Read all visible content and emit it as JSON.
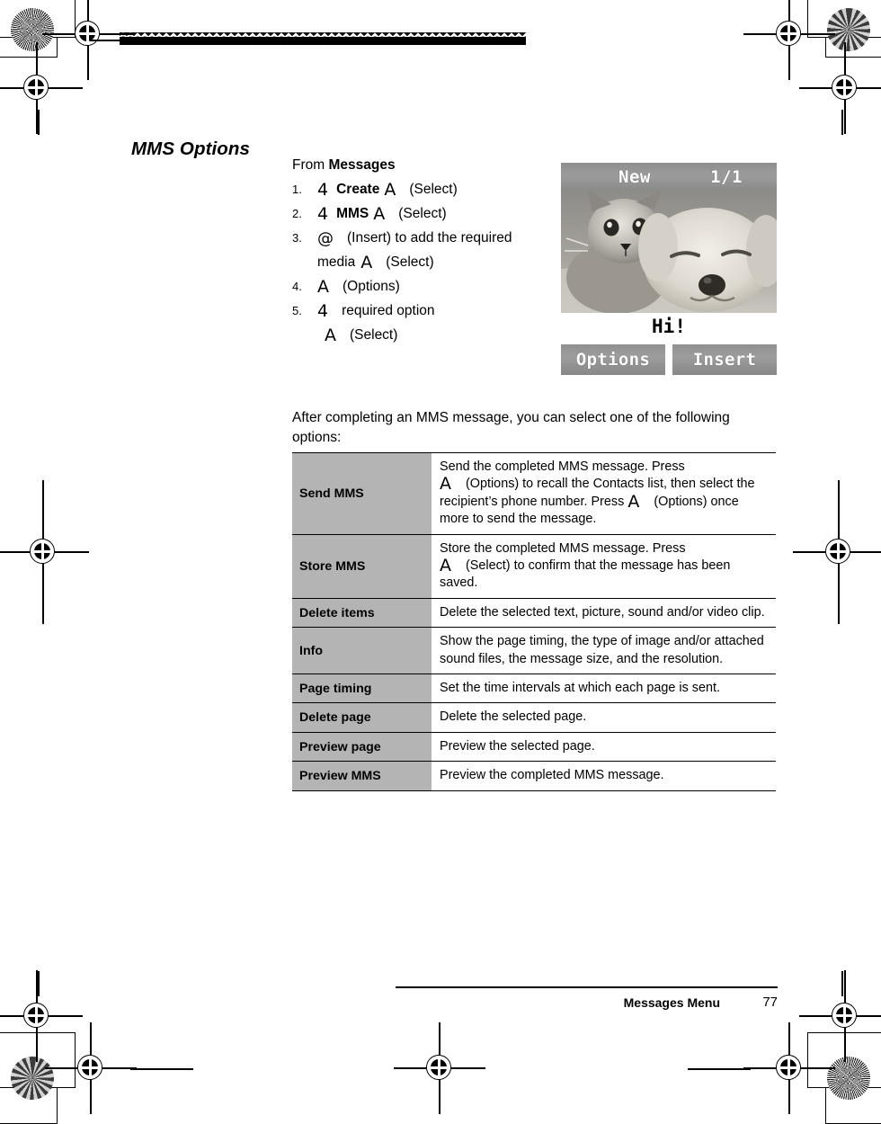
{
  "page": {
    "title": "MMS Options",
    "intro_lead": "From ",
    "intro_bold": "Messages",
    "after_paragraph": "After completing an MMS message, you can select one of the following options:",
    "stray_mark": "."
  },
  "steps": [
    {
      "num": "1.",
      "key_glyph": "4",
      "bold_text": "Create",
      "key_glyph_2": "A",
      "action": "(Select)"
    },
    {
      "num": "2.",
      "key_glyph": "4",
      "bold_text": "MMS",
      "key_glyph_2": "A",
      "action": "(Select)"
    },
    {
      "num": "3.",
      "key_glyph": "@",
      "action": "(Insert) to add the required",
      "cont_text": "media",
      "cont_glyph": "A",
      "cont_action": "(Select)"
    },
    {
      "num": "4.",
      "key_glyph": "A",
      "action": "(Options)"
    },
    {
      "num": "5.",
      "key_glyph": "4",
      "action": "required option",
      "cont_glyph": "A",
      "cont_action": "(Select)"
    }
  ],
  "phone_screen": {
    "header_title": "New",
    "header_page": "1/1",
    "caption": "Hi!",
    "softkey_left": "Options",
    "softkey_right": "Insert",
    "photo_alt": "kitten-and-puppy-photo"
  },
  "options_table": {
    "rows": [
      {
        "label": "Send MMS",
        "desc_parts": [
          {
            "t": "Send the completed MMS message. Press"
          },
          {
            "br": true
          },
          {
            "glyph": "A"
          },
          {
            "gap": "M"
          },
          {
            "t": "(Options) to recall the Contacts list, then select the recipient’s phone number. Press "
          },
          {
            "glyph": "A"
          },
          {
            "gap": "M"
          },
          {
            "t": "(Options) once more to send the message."
          }
        ]
      },
      {
        "label": "Store MMS",
        "desc_parts": [
          {
            "t": "Store the completed MMS message. Press"
          },
          {
            "br": true
          },
          {
            "glyph": "A"
          },
          {
            "gap": "M"
          },
          {
            "t": "(Select) to confirm that the message has been saved."
          }
        ]
      },
      {
        "label": "Delete items",
        "desc_parts": [
          {
            "t": "Delete the selected text, picture, sound and/or video clip."
          }
        ]
      },
      {
        "label": "Info",
        "desc_parts": [
          {
            "t": "Show the page timing, the type of image and/or attached sound files, the message size, and the resolution."
          }
        ]
      },
      {
        "label": "Page timing",
        "desc_parts": [
          {
            "t": "Set the time intervals at which each page is sent."
          }
        ]
      },
      {
        "label": "Delete page",
        "desc_parts": [
          {
            "t": "Delete the selected page."
          }
        ]
      },
      {
        "label": "Preview page",
        "desc_parts": [
          {
            "t": "Preview the selected page."
          }
        ]
      },
      {
        "label": "Preview MMS",
        "desc_parts": [
          {
            "t": "Preview the completed MMS message."
          }
        ]
      }
    ]
  },
  "footer": {
    "section": "Messages Menu",
    "page_number": "77"
  },
  "colors": {
    "table_label_bg": "#b4b4b4",
    "rule": "#000000",
    "phone_chrome": "#949494",
    "paper": "#ffffff"
  }
}
